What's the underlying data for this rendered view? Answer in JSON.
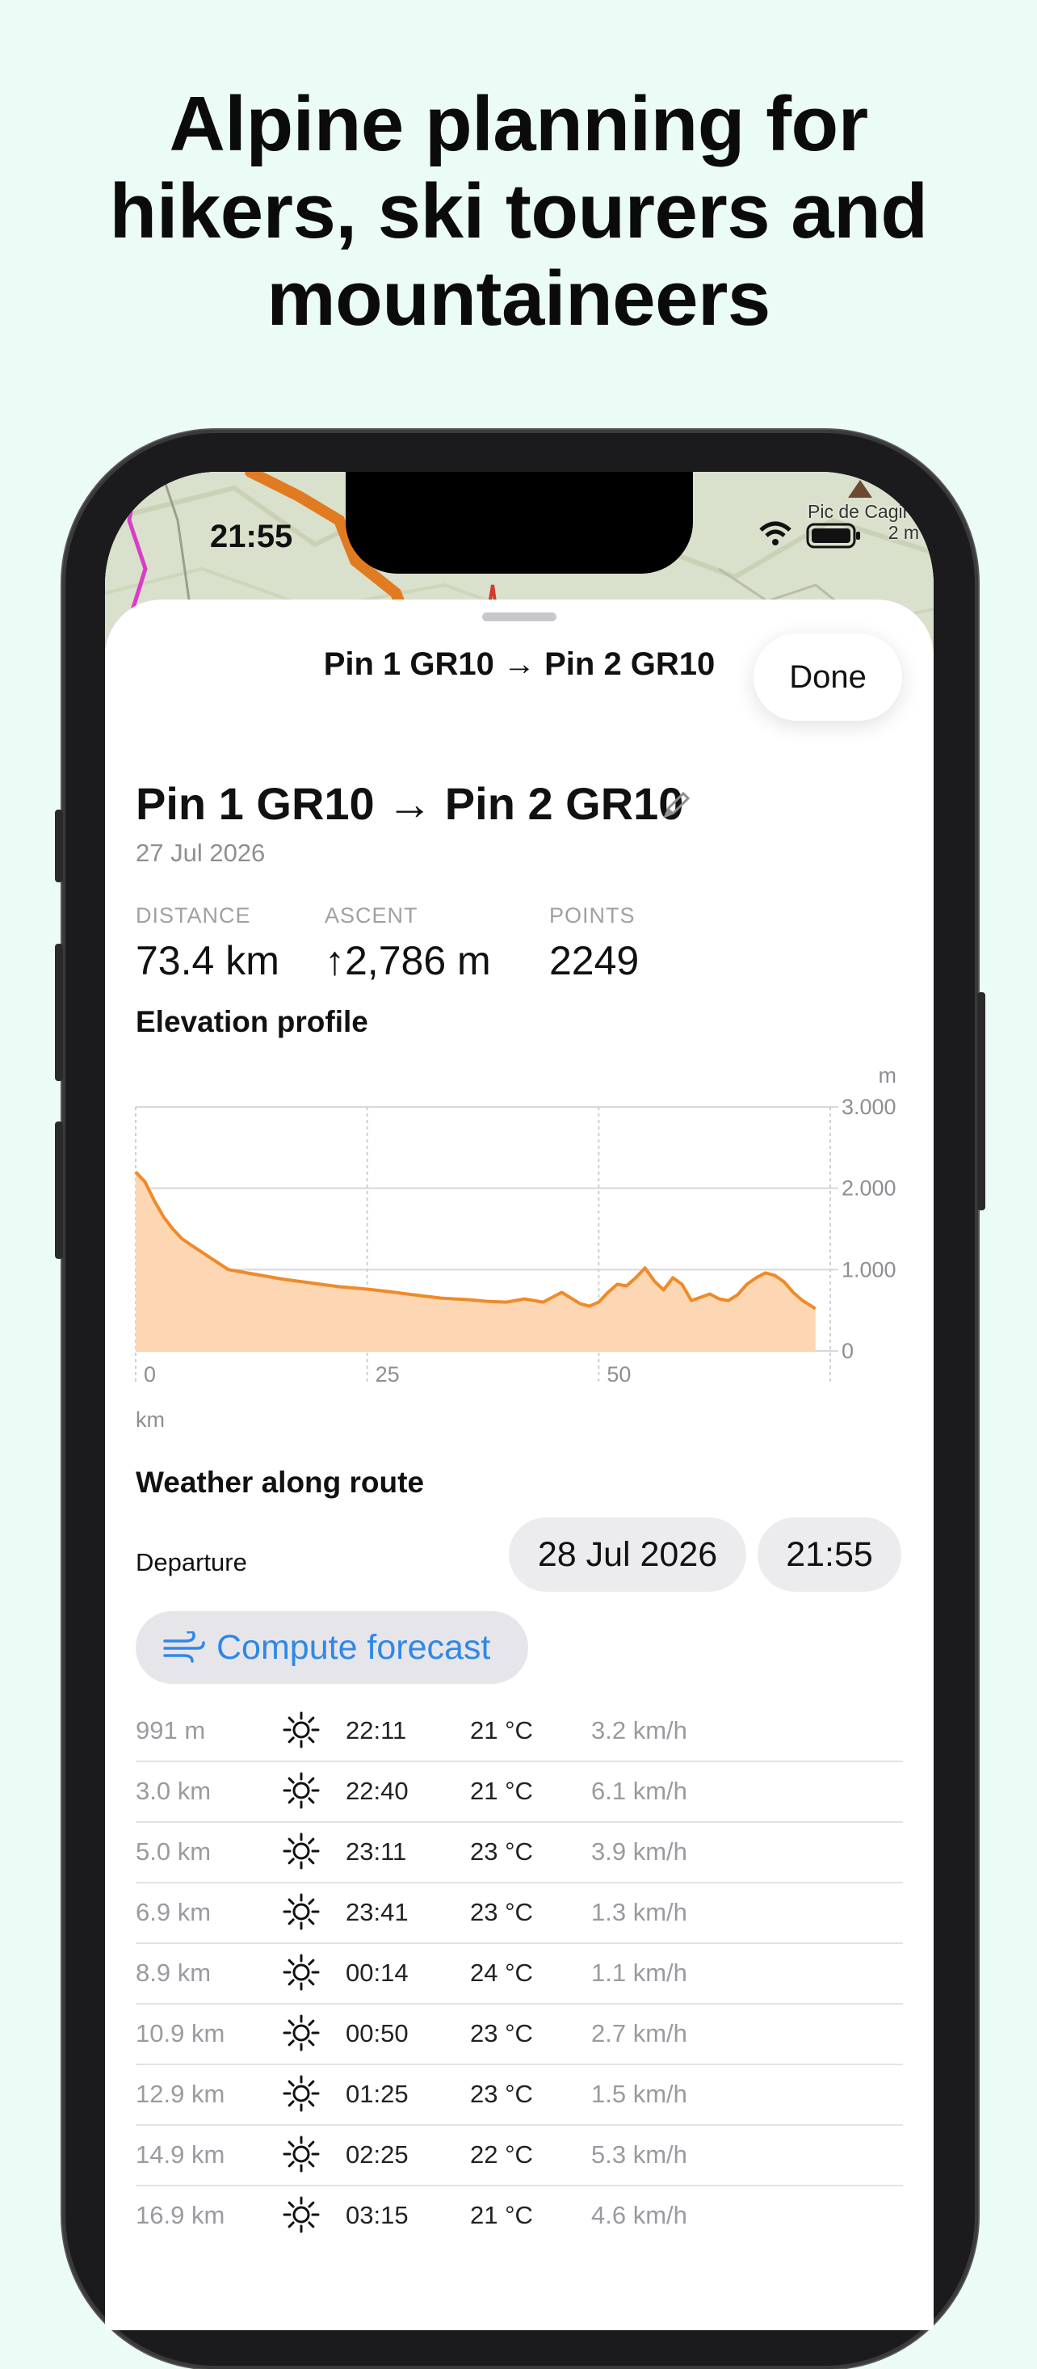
{
  "headline": [
    "Alpine planning for",
    "hikers, ski tourers and",
    "mountaineers"
  ],
  "status": {
    "time": "21:55"
  },
  "map": {
    "peak_label": "Pic de Cagire",
    "peak_sub": "2 m"
  },
  "sheet": {
    "nav_title": "Pin 1 GR10 → Pin 2 GR10",
    "done_label": "Done",
    "route_title": "Pin 1 GR10 → Pin 2 GR10",
    "route_date": "27 Jul 2026",
    "stats": [
      {
        "label": "DISTANCE",
        "value": "73.4 km"
      },
      {
        "label": "ASCENT",
        "value": "↑2,786 m"
      },
      {
        "label": "POINTS",
        "value": "2249"
      }
    ],
    "elevation_title": "Elevation profile",
    "weather_title": "Weather along route",
    "departure_label": "Departure",
    "departure_date": "28 Jul 2026",
    "departure_time": "21:55",
    "forecast_label": "Compute forecast"
  },
  "colors": {
    "accent": "#2f88e8",
    "profile_line": "#f08a28",
    "profile_fill": "#fdd7b4"
  },
  "chart_data": {
    "type": "area",
    "xlabel": "km",
    "ylabel": "m",
    "xlim": [
      0,
      75
    ],
    "ylim": [
      0,
      3000
    ],
    "x_ticks": [
      "0",
      "25",
      "50"
    ],
    "y_ticks": [
      "3.000",
      "2.000",
      "1.000",
      "0"
    ],
    "grid": true,
    "x": [
      0,
      1,
      2,
      3,
      4,
      5,
      6,
      8,
      10,
      12,
      14,
      16,
      18,
      20,
      22,
      25,
      28,
      30,
      33,
      36,
      38,
      40,
      42,
      44,
      46,
      48,
      49,
      50,
      51,
      52,
      53,
      54,
      55,
      56,
      57,
      58,
      59,
      60,
      61,
      62,
      63,
      64,
      65,
      66,
      67,
      68,
      69,
      70,
      71,
      72,
      73.4
    ],
    "y": [
      2200,
      2080,
      1850,
      1650,
      1500,
      1380,
      1300,
      1150,
      1000,
      960,
      920,
      880,
      850,
      820,
      790,
      760,
      720,
      690,
      650,
      630,
      610,
      600,
      640,
      600,
      720,
      580,
      550,
      600,
      720,
      820,
      800,
      900,
      1020,
      860,
      750,
      900,
      820,
      620,
      660,
      700,
      640,
      620,
      690,
      820,
      900,
      960,
      930,
      850,
      720,
      620,
      520
    ]
  },
  "weather_rows": [
    {
      "distance": "991 m",
      "icon": "sun-icon",
      "time": "22:11",
      "temp": "21 °C",
      "wind": "3.2 km/h"
    },
    {
      "distance": "3.0 km",
      "icon": "sun-icon",
      "time": "22:40",
      "temp": "21 °C",
      "wind": "6.1 km/h"
    },
    {
      "distance": "5.0 km",
      "icon": "sun-icon",
      "time": "23:11",
      "temp": "23 °C",
      "wind": "3.9 km/h"
    },
    {
      "distance": "6.9 km",
      "icon": "sun-icon",
      "time": "23:41",
      "temp": "23 °C",
      "wind": "1.3 km/h"
    },
    {
      "distance": "8.9 km",
      "icon": "sun-icon",
      "time": "00:14",
      "temp": "24 °C",
      "wind": "1.1 km/h"
    },
    {
      "distance": "10.9 km",
      "icon": "sun-icon",
      "time": "00:50",
      "temp": "23 °C",
      "wind": "2.7 km/h"
    },
    {
      "distance": "12.9 km",
      "icon": "sun-icon",
      "time": "01:25",
      "temp": "23 °C",
      "wind": "1.5 km/h"
    },
    {
      "distance": "14.9 km",
      "icon": "sun-icon",
      "time": "02:25",
      "temp": "22 °C",
      "wind": "5.3 km/h"
    },
    {
      "distance": "16.9 km",
      "icon": "sun-icon",
      "time": "03:15",
      "temp": "21 °C",
      "wind": "4.6 km/h"
    }
  ]
}
